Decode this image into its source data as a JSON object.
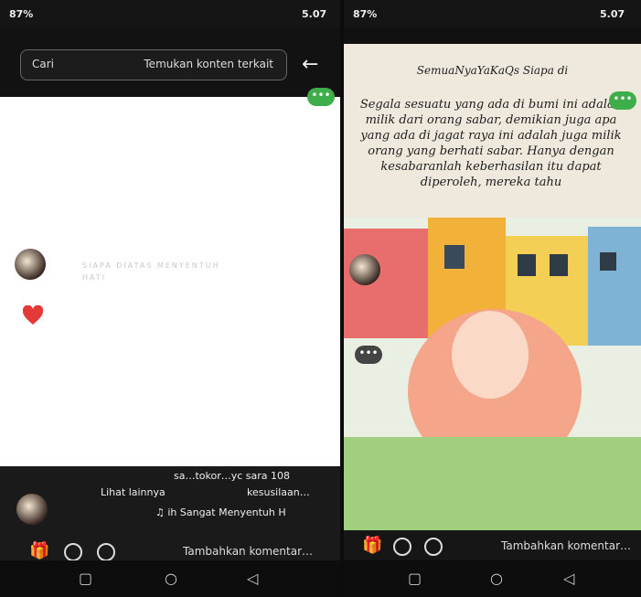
{
  "left_screen": {
    "status_time": "5.07",
    "status_battery": "87%",
    "search": {
      "placeholder": "Temukan konten terkait",
      "action_label": "Cari"
    },
    "faint_text_1": "SIAPA DIATAS MENYENTUH",
    "faint_text_2": "HATI",
    "username_line": "sa…tokor…yc sara 108",
    "caption": "kesusilaan…",
    "see_more": "Lihat lainnya",
    "music": "♫ ih Sangat Menyentuh H",
    "comment_placeholder": "Tambahkan komentar…"
  },
  "right_screen": {
    "status_time": "5.07",
    "status_battery": "87%",
    "quote_title": "SemuaNyaYaKaQs Siapa di",
    "quote": "Segala sesuatu yang ada di bumi ini adalah milik dari orang sabar, demikian juga apa yang ada di jagat raya ini adalah juga milik orang yang berhati sabar. Hanya dengan kesabaranlah keberhasilan itu dapat diperoleh, mereka tahu",
    "comment_placeholder": "Tambahkan komentar…"
  },
  "colors": {
    "accent_green": "#3eae4a",
    "heart_red": "#e53935"
  }
}
